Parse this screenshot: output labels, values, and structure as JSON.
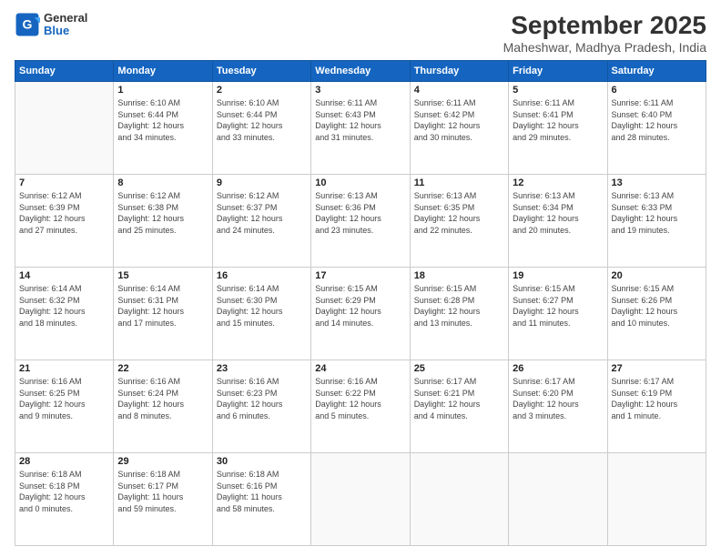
{
  "header": {
    "logo_line1": "General",
    "logo_line2": "Blue",
    "title": "September 2025",
    "subtitle": "Maheshwar, Madhya Pradesh, India"
  },
  "weekdays": [
    "Sunday",
    "Monday",
    "Tuesday",
    "Wednesday",
    "Thursday",
    "Friday",
    "Saturday"
  ],
  "weeks": [
    [
      {
        "day": "",
        "info": ""
      },
      {
        "day": "1",
        "info": "Sunrise: 6:10 AM\nSunset: 6:44 PM\nDaylight: 12 hours\nand 34 minutes."
      },
      {
        "day": "2",
        "info": "Sunrise: 6:10 AM\nSunset: 6:44 PM\nDaylight: 12 hours\nand 33 minutes."
      },
      {
        "day": "3",
        "info": "Sunrise: 6:11 AM\nSunset: 6:43 PM\nDaylight: 12 hours\nand 31 minutes."
      },
      {
        "day": "4",
        "info": "Sunrise: 6:11 AM\nSunset: 6:42 PM\nDaylight: 12 hours\nand 30 minutes."
      },
      {
        "day": "5",
        "info": "Sunrise: 6:11 AM\nSunset: 6:41 PM\nDaylight: 12 hours\nand 29 minutes."
      },
      {
        "day": "6",
        "info": "Sunrise: 6:11 AM\nSunset: 6:40 PM\nDaylight: 12 hours\nand 28 minutes."
      }
    ],
    [
      {
        "day": "7",
        "info": "Sunrise: 6:12 AM\nSunset: 6:39 PM\nDaylight: 12 hours\nand 27 minutes."
      },
      {
        "day": "8",
        "info": "Sunrise: 6:12 AM\nSunset: 6:38 PM\nDaylight: 12 hours\nand 25 minutes."
      },
      {
        "day": "9",
        "info": "Sunrise: 6:12 AM\nSunset: 6:37 PM\nDaylight: 12 hours\nand 24 minutes."
      },
      {
        "day": "10",
        "info": "Sunrise: 6:13 AM\nSunset: 6:36 PM\nDaylight: 12 hours\nand 23 minutes."
      },
      {
        "day": "11",
        "info": "Sunrise: 6:13 AM\nSunset: 6:35 PM\nDaylight: 12 hours\nand 22 minutes."
      },
      {
        "day": "12",
        "info": "Sunrise: 6:13 AM\nSunset: 6:34 PM\nDaylight: 12 hours\nand 20 minutes."
      },
      {
        "day": "13",
        "info": "Sunrise: 6:13 AM\nSunset: 6:33 PM\nDaylight: 12 hours\nand 19 minutes."
      }
    ],
    [
      {
        "day": "14",
        "info": "Sunrise: 6:14 AM\nSunset: 6:32 PM\nDaylight: 12 hours\nand 18 minutes."
      },
      {
        "day": "15",
        "info": "Sunrise: 6:14 AM\nSunset: 6:31 PM\nDaylight: 12 hours\nand 17 minutes."
      },
      {
        "day": "16",
        "info": "Sunrise: 6:14 AM\nSunset: 6:30 PM\nDaylight: 12 hours\nand 15 minutes."
      },
      {
        "day": "17",
        "info": "Sunrise: 6:15 AM\nSunset: 6:29 PM\nDaylight: 12 hours\nand 14 minutes."
      },
      {
        "day": "18",
        "info": "Sunrise: 6:15 AM\nSunset: 6:28 PM\nDaylight: 12 hours\nand 13 minutes."
      },
      {
        "day": "19",
        "info": "Sunrise: 6:15 AM\nSunset: 6:27 PM\nDaylight: 12 hours\nand 11 minutes."
      },
      {
        "day": "20",
        "info": "Sunrise: 6:15 AM\nSunset: 6:26 PM\nDaylight: 12 hours\nand 10 minutes."
      }
    ],
    [
      {
        "day": "21",
        "info": "Sunrise: 6:16 AM\nSunset: 6:25 PM\nDaylight: 12 hours\nand 9 minutes."
      },
      {
        "day": "22",
        "info": "Sunrise: 6:16 AM\nSunset: 6:24 PM\nDaylight: 12 hours\nand 8 minutes."
      },
      {
        "day": "23",
        "info": "Sunrise: 6:16 AM\nSunset: 6:23 PM\nDaylight: 12 hours\nand 6 minutes."
      },
      {
        "day": "24",
        "info": "Sunrise: 6:16 AM\nSunset: 6:22 PM\nDaylight: 12 hours\nand 5 minutes."
      },
      {
        "day": "25",
        "info": "Sunrise: 6:17 AM\nSunset: 6:21 PM\nDaylight: 12 hours\nand 4 minutes."
      },
      {
        "day": "26",
        "info": "Sunrise: 6:17 AM\nSunset: 6:20 PM\nDaylight: 12 hours\nand 3 minutes."
      },
      {
        "day": "27",
        "info": "Sunrise: 6:17 AM\nSunset: 6:19 PM\nDaylight: 12 hours\nand 1 minute."
      }
    ],
    [
      {
        "day": "28",
        "info": "Sunrise: 6:18 AM\nSunset: 6:18 PM\nDaylight: 12 hours\nand 0 minutes."
      },
      {
        "day": "29",
        "info": "Sunrise: 6:18 AM\nSunset: 6:17 PM\nDaylight: 11 hours\nand 59 minutes."
      },
      {
        "day": "30",
        "info": "Sunrise: 6:18 AM\nSunset: 6:16 PM\nDaylight: 11 hours\nand 58 minutes."
      },
      {
        "day": "",
        "info": ""
      },
      {
        "day": "",
        "info": ""
      },
      {
        "day": "",
        "info": ""
      },
      {
        "day": "",
        "info": ""
      }
    ]
  ]
}
